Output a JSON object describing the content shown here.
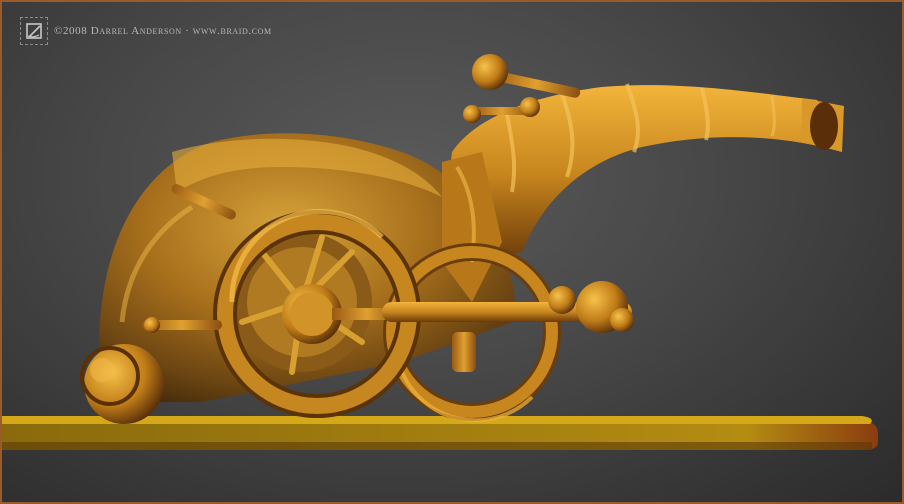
{
  "credit": {
    "text": "©2008 Darrel Anderson · www.braid.com",
    "text_color": "#b9b9b9"
  },
  "colors": {
    "frame_border": "#9a5a2a",
    "background_center": "#5a5a5a",
    "background_edge": "#2b2b2b",
    "sculpture_main": "#c8861e",
    "sculpture_highlight": "#f2b43a",
    "sculpture_shadow": "#6a3a0a",
    "base_plate": "#b08a10"
  },
  "icons": {
    "logo": "braid-logo-icon"
  }
}
